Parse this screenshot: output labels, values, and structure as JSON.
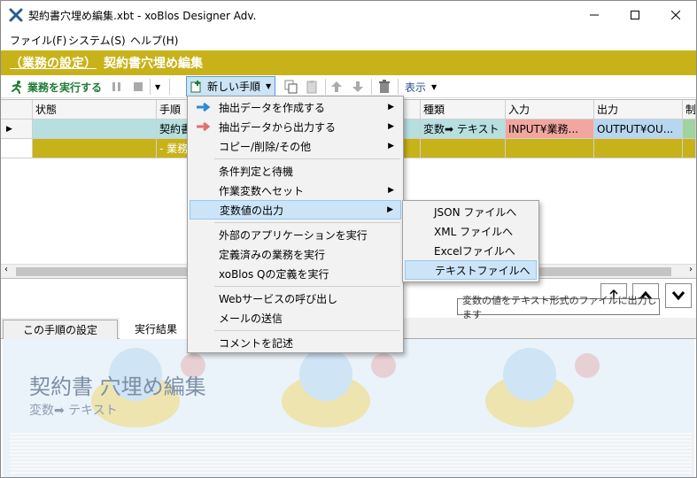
{
  "window": {
    "title": "契約書穴埋め編集.xbt - xoBlos Designer Adv.",
    "controls": [
      "minimize",
      "maximize",
      "close"
    ]
  },
  "menubar": {
    "items": [
      "ファイル(F)",
      "システム(S)",
      "ヘルプ(H)"
    ]
  },
  "banner": {
    "category": "（業務の設定）",
    "name": "契約書穴埋め編集"
  },
  "toolbar": {
    "run_label": "業務を実行する",
    "new_step_label": "新しい手順",
    "view_label": "表示"
  },
  "grid": {
    "headers": {
      "status": "状態",
      "step": "手順",
      "type": "種類",
      "input": "入力",
      "output": "出力",
      "extra": "制"
    },
    "rows": [
      {
        "step": "契約書",
        "type": "変数➡ テキスト",
        "input": "INPUT¥業務...",
        "output": "OUTPUT¥OU..."
      },
      {
        "step": "- 業務"
      }
    ]
  },
  "context_menu": {
    "items": [
      {
        "label": "抽出データを作成する",
        "icon": "blue-arrow-icon",
        "has_submenu": true
      },
      {
        "label": "抽出データから出力する",
        "icon": "red-arrow-icon",
        "has_submenu": true
      },
      {
        "label": "コピー/削除/その他",
        "has_submenu": true
      },
      {
        "label": "条件判定と待機",
        "has_submenu": false
      },
      {
        "label": "作業変数へセット",
        "has_submenu": true
      },
      {
        "label": "変数値の出力",
        "has_submenu": true,
        "highlighted": true
      },
      {
        "label": "外部のアプリケーションを実行",
        "has_submenu": false
      },
      {
        "label": "定義済みの業務を実行",
        "has_submenu": false
      },
      {
        "label": "xoBlos Qの定義を実行",
        "has_submenu": false
      },
      {
        "label": "Webサービスの呼び出し",
        "has_submenu": false
      },
      {
        "label": "メールの送信",
        "has_submenu": false
      },
      {
        "label": "コメントを記述",
        "has_submenu": false
      }
    ]
  },
  "submenu": {
    "items": [
      {
        "label": "JSON ファイルへ"
      },
      {
        "label": "XML ファイルへ"
      },
      {
        "label": "Excelファイルへ"
      },
      {
        "label": "テキストファイルへ",
        "highlighted": true
      }
    ]
  },
  "tooltip": "変数の値をテキスト形式のファイルに出力します",
  "bottom": {
    "tabs": [
      "この手順の設定",
      "実行結果"
    ],
    "active_tab": "実行結果",
    "title": "契約書  穴埋め編集",
    "subtitle": "変数➡ テキスト",
    "nav": [
      "up-arrow",
      "chevron-up",
      "chevron-down"
    ]
  },
  "colors": {
    "banner": "#c8b21a",
    "row_selected": "#b7dfe0",
    "input_cell": "#f1a7a0",
    "output_cell": "#b7d7f0",
    "menu_highlight": "#cce4f7"
  }
}
